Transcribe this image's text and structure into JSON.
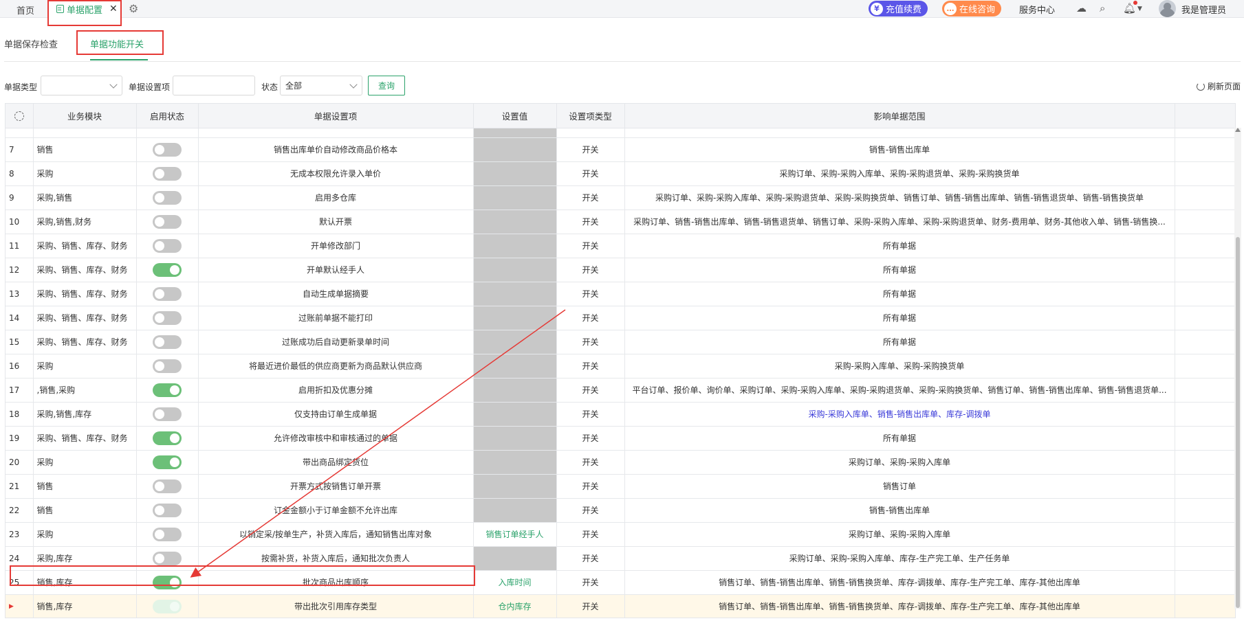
{
  "topbar": {
    "home_tab": "首页",
    "active_tab": "单据配置",
    "close_glyph": "✕",
    "recharge_label": "充值续费",
    "consult_label": "在线咨询",
    "service_label": "服务中心",
    "user_name": "我是管理员",
    "user_chevron": "▼"
  },
  "subtabs": {
    "tab1": "单据保存检查",
    "tab2": "单据功能开关"
  },
  "filters": {
    "doc_type_label": "单据类型",
    "doc_type_value": "",
    "setting_label": "单据设置项",
    "setting_value": "",
    "status_label": "状态",
    "status_value": "全部",
    "query_label": "查询",
    "refresh_label": "刷新页面"
  },
  "table": {
    "headers": [
      "业务模块",
      "启用状态",
      "单据设置项",
      "设置值",
      "设置项类型",
      "影响单据范围"
    ],
    "rows": [
      {
        "no": "7",
        "module": "销售",
        "on": false,
        "item": "销售出库单价自动修改商品价格本",
        "value": "",
        "type": "开关",
        "scope": "销售-销售出库单"
      },
      {
        "no": "8",
        "module": "采购",
        "on": false,
        "item": "无成本权限允许录入单价",
        "value": "",
        "type": "开关",
        "scope": "采购订单、采购-采购入库单、采购-采购退货单、采购-采购换货单"
      },
      {
        "no": "9",
        "module": "采购,销售",
        "on": false,
        "item": "启用多仓库",
        "value": "",
        "type": "开关",
        "scope": "采购订单、采购-采购入库单、采购-采购退货单、采购-采购换货单、销售订单、销售-销售出库单、销售-销售退货单、销售-销售换货单"
      },
      {
        "no": "10",
        "module": "采购,销售,财务",
        "on": false,
        "item": "默认开票",
        "value": "",
        "type": "开关",
        "scope": "采购订单、销售-销售出库单、销售-销售退货单、销售订单、采购-采购入库单、采购-采购退货单、财务-费用单、财务-其他收入单、销售-销售换..."
      },
      {
        "no": "11",
        "module": "采购、销售、库存、财务",
        "on": false,
        "item": "开单修改部门",
        "value": "",
        "type": "开关",
        "scope": "所有单据"
      },
      {
        "no": "12",
        "module": "采购、销售、库存、财务",
        "on": true,
        "item": "开单默认经手人",
        "value": "",
        "type": "开关",
        "scope": "所有单据"
      },
      {
        "no": "13",
        "module": "采购、销售、库存、财务",
        "on": false,
        "item": "自动生成单据摘要",
        "value": "",
        "type": "开关",
        "scope": "所有单据"
      },
      {
        "no": "14",
        "module": "采购、销售、库存、财务",
        "on": false,
        "item": "过账前单据不能打印",
        "value": "",
        "type": "开关",
        "scope": "所有单据"
      },
      {
        "no": "15",
        "module": "采购、销售、库存、财务",
        "on": false,
        "item": "过账成功后自动更新录单时间",
        "value": "",
        "type": "开关",
        "scope": "所有单据"
      },
      {
        "no": "16",
        "module": "采购",
        "on": false,
        "item": "将最近进价最低的供应商更新为商品默认供应商",
        "value": "",
        "type": "开关",
        "scope": "采购-采购入库单、采购-采购换货单"
      },
      {
        "no": "17",
        "module": ",销售,采购",
        "on": true,
        "item": "启用折扣及优惠分摊",
        "value": "",
        "type": "开关",
        "scope": "平台订单、报价单、询价单、采购订单、采购-采购入库单、采购-采购退货单、采购-采购换货单、销售订单、销售-销售出库单、销售-销售退货单..."
      },
      {
        "no": "18",
        "module": "采购,销售,库存",
        "on": false,
        "item": "仅支持由订单生成单据",
        "value": "",
        "type": "开关",
        "scope": "采购-采购入库单、销售-销售出库单、库存-调拨单",
        "blue": true
      },
      {
        "no": "19",
        "module": "采购、销售、库存、财务",
        "on": true,
        "item": "允许修改审核中和审核通过的单据",
        "value": "",
        "type": "开关",
        "scope": "所有单据"
      },
      {
        "no": "20",
        "module": "采购",
        "on": true,
        "item": "带出商品绑定货位",
        "value": "",
        "type": "开关",
        "scope": "采购订单、采购-采购入库单"
      },
      {
        "no": "21",
        "module": "销售",
        "on": false,
        "item": "开票方式按销售订单开票",
        "value": "",
        "type": "开关",
        "scope": "销售订单"
      },
      {
        "no": "22",
        "module": "销售",
        "on": false,
        "item": "订金金额小于订单金额不允许出库",
        "value": "",
        "type": "开关",
        "scope": "销售-销售出库单"
      },
      {
        "no": "23",
        "module": "采购",
        "on": false,
        "item": "以销定采/按单生产，补货入库后，通知销售出库对象",
        "value": "销售订单经手人",
        "type": "开关",
        "scope": "采购订单、采购-采购入库单"
      },
      {
        "no": "24",
        "module": "采购,库存",
        "on": false,
        "item": "按需补货，补货入库后，通知批次负责人",
        "value": "",
        "type": "开关",
        "scope": "采购订单、采购-采购入库单、库存-生产完工单、生产任务单"
      },
      {
        "no": "25",
        "module": "销售,库存",
        "on": true,
        "item": "批次商品出库顺序",
        "value": "入库时间",
        "type": "开关",
        "scope": "销售订单、销售-销售出库单、销售-销售换货单、库存-调拨单、库存-生产完工单、库存-其他出库单"
      },
      {
        "no": "▶",
        "module": "销售,库存",
        "on": "faint",
        "item": "带出批次引用库存类型",
        "value": "仓内库存",
        "type": "开关",
        "scope": "销售订单、销售-销售出库单、销售-销售换货单、库存-调拨单、库存-生产完工单、库存-其他出库单",
        "selected": true
      }
    ]
  }
}
